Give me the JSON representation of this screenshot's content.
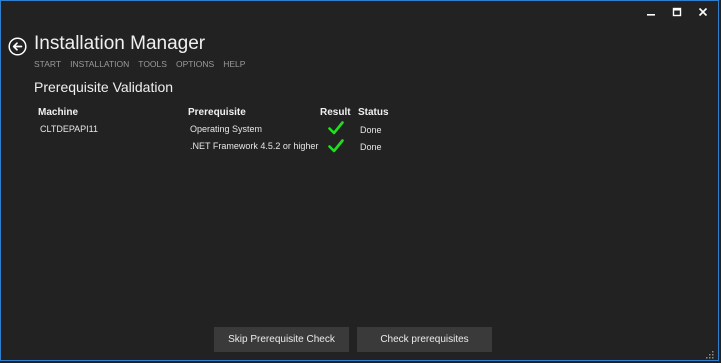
{
  "window": {
    "controls": {
      "minimize_icon": "minimize-icon",
      "maximize_icon": "maximize-icon",
      "close_icon": "close-icon"
    }
  },
  "header": {
    "title": "Installation Manager",
    "back_icon": "back-arrow-icon"
  },
  "nav": {
    "items": [
      "START",
      "INSTALLATION",
      "TOOLS",
      "OPTIONS",
      "HELP"
    ]
  },
  "section": {
    "title": "Prerequisite Validation"
  },
  "table": {
    "columns": [
      "Machine",
      "Prerequisite",
      "Result",
      "Status"
    ],
    "rows": [
      {
        "machine": "CLTDEPAPI11",
        "prerequisite": "Operating System",
        "result_icon": "checkmark-icon",
        "status": "Done"
      },
      {
        "machine": "",
        "prerequisite": ".NET Framework 4.5.2 or higher",
        "result_icon": "checkmark-icon",
        "status": "Done"
      }
    ]
  },
  "buttons": {
    "skip": "Skip Prerequisite Check",
    "check": "Check prerequisites"
  },
  "colors": {
    "background": "#222222",
    "accent_border": "#2f7fd1",
    "check_green": "#22dd22",
    "button_bg": "#3a3a3a"
  }
}
